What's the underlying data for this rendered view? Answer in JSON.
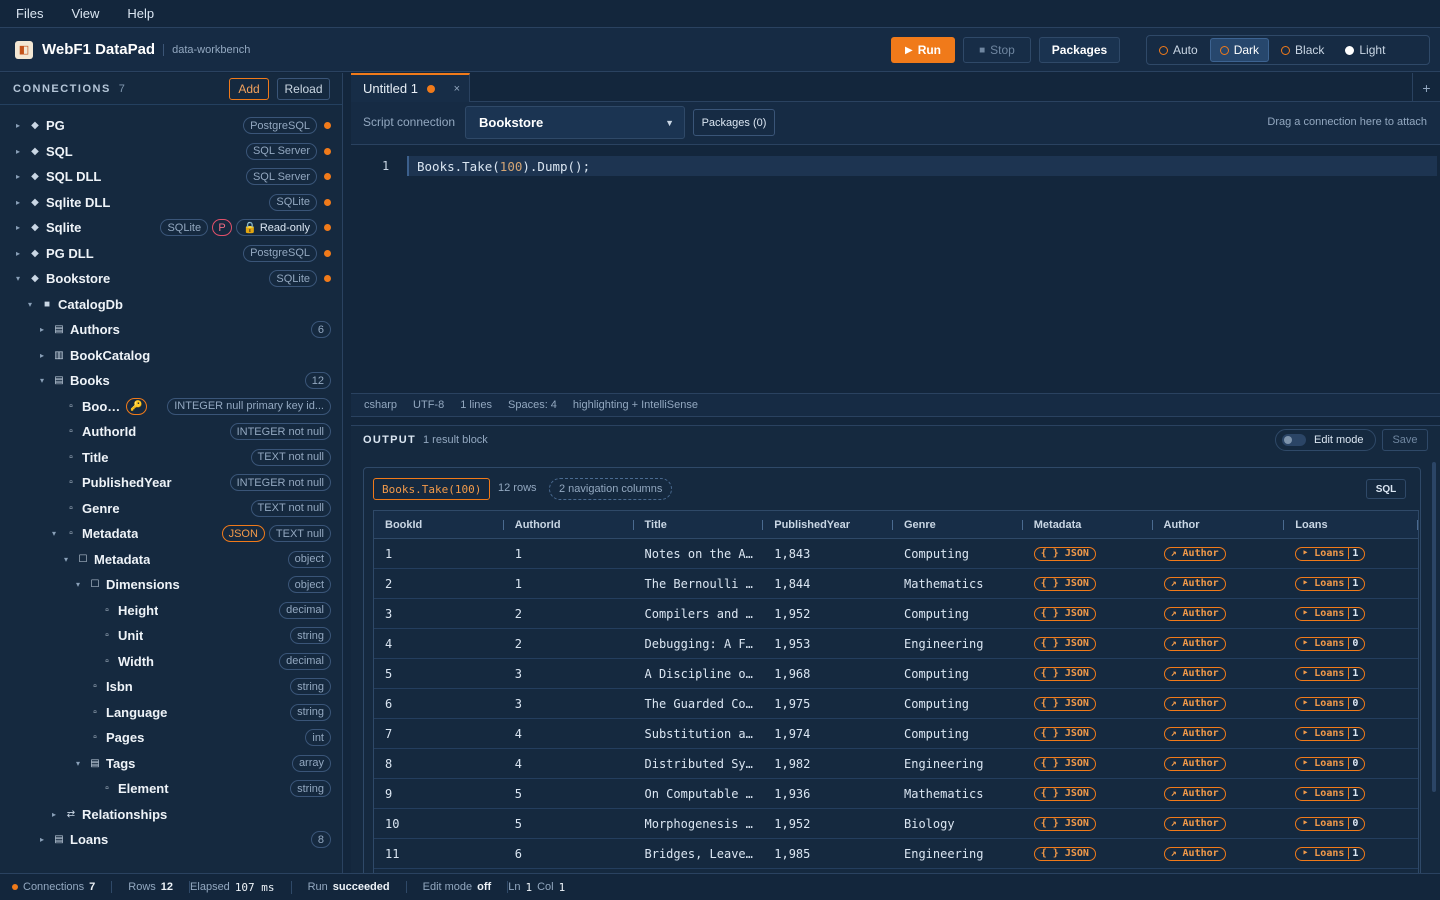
{
  "menu": [
    "Files",
    "View",
    "Help"
  ],
  "app": {
    "logo": "logo-icon",
    "title": "WebF1 DataPad",
    "subtitle": "data-workbench"
  },
  "toolbar": {
    "run": "Run",
    "stop": "Stop",
    "packages": "Packages"
  },
  "themes": [
    "Auto",
    "Dark",
    "Black",
    "Light"
  ],
  "theme_selected": "Dark",
  "sidebar": {
    "header": "CONNECTIONS",
    "count": "7",
    "add": "Add",
    "reload": "Reload",
    "items": [
      {
        "caret": "▸",
        "icon": "◆",
        "name": "PG",
        "tags": [
          "PostgreSQL"
        ],
        "dot": true
      },
      {
        "caret": "▸",
        "icon": "◆",
        "name": "SQL",
        "tags": [
          "SQL Server"
        ],
        "dot": true
      },
      {
        "caret": "▸",
        "icon": "◆",
        "name": "SQL DLL",
        "tags": [
          "SQL Server"
        ],
        "dot": true
      },
      {
        "caret": "▸",
        "icon": "◆",
        "name": "Sqlite DLL",
        "tags": [
          "SQLite"
        ],
        "dot": true
      },
      {
        "caret": "▸",
        "icon": "◆",
        "name": "Sqlite",
        "tags": [
          "SQLite"
        ],
        "p": "P",
        "readonly": "🔒 Read-only",
        "dot": true
      },
      {
        "caret": "▸",
        "icon": "◆",
        "name": "PG DLL",
        "tags": [
          "PostgreSQL"
        ],
        "dot": true
      },
      {
        "caret": "▾",
        "icon": "◆",
        "name": "Bookstore",
        "tags": [
          "SQLite"
        ],
        "dot": true
      },
      {
        "caret": "▾",
        "icon": "■",
        "name": "CatalogDb",
        "indent": 1
      },
      {
        "caret": "▸",
        "icon": "▤",
        "name": "Authors",
        "indent": 2,
        "tags": [
          "6"
        ]
      },
      {
        "caret": "▸",
        "icon": "▥",
        "name": "BookCatalog",
        "indent": 2
      },
      {
        "caret": "▾",
        "icon": "▤",
        "name": "Books",
        "indent": 2,
        "tags": [
          "12"
        ]
      },
      {
        "caret": "",
        "icon": "▫",
        "name": "Boo…",
        "indent": 3,
        "key": "🔑",
        "tags": [
          "INTEGER null primary key id..."
        ]
      },
      {
        "caret": "",
        "icon": "▫",
        "name": "AuthorId",
        "indent": 3,
        "tags": [
          "INTEGER not null"
        ]
      },
      {
        "caret": "",
        "icon": "▫",
        "name": "Title",
        "indent": 3,
        "tags": [
          "TEXT not null"
        ]
      },
      {
        "caret": "",
        "icon": "▫",
        "name": "PublishedYear",
        "indent": 3,
        "tags": [
          "INTEGER not null"
        ]
      },
      {
        "caret": "",
        "icon": "▫",
        "name": "Genre",
        "indent": 3,
        "tags": [
          "TEXT not null"
        ]
      },
      {
        "caret": "▾",
        "icon": "▫",
        "name": "Metadata",
        "indent": 3,
        "json": "JSON",
        "tags": [
          "TEXT null"
        ]
      },
      {
        "caret": "▾",
        "icon": "☐",
        "name": "Metadata",
        "indent": 4,
        "tags": [
          "object"
        ]
      },
      {
        "caret": "▾",
        "icon": "☐",
        "name": "Dimensions",
        "indent": 5,
        "tags": [
          "object"
        ]
      },
      {
        "caret": "",
        "icon": "▫",
        "name": "Height",
        "indent": 6,
        "tags": [
          "decimal"
        ]
      },
      {
        "caret": "",
        "icon": "▫",
        "name": "Unit",
        "indent": 6,
        "tags": [
          "string"
        ]
      },
      {
        "caret": "",
        "icon": "▫",
        "name": "Width",
        "indent": 6,
        "tags": [
          "decimal"
        ]
      },
      {
        "caret": "",
        "icon": "▫",
        "name": "Isbn",
        "indent": 5,
        "tags": [
          "string"
        ]
      },
      {
        "caret": "",
        "icon": "▫",
        "name": "Language",
        "indent": 5,
        "tags": [
          "string"
        ]
      },
      {
        "caret": "",
        "icon": "▫",
        "name": "Pages",
        "indent": 5,
        "tags": [
          "int"
        ]
      },
      {
        "caret": "▾",
        "icon": "▤",
        "name": "Tags",
        "indent": 5,
        "tags": [
          "array"
        ]
      },
      {
        "caret": "",
        "icon": "▫",
        "name": "Element",
        "indent": 6,
        "tags": [
          "string"
        ]
      },
      {
        "caret": "▸",
        "icon": "⇄",
        "name": "Relationships",
        "indent": 3
      },
      {
        "caret": "▸",
        "icon": "▤",
        "name": "Loans",
        "indent": 2,
        "tags": [
          "8"
        ]
      }
    ]
  },
  "tab": {
    "label": "Untitled 1",
    "close": "×",
    "new": "+"
  },
  "script": {
    "connection_label": "Script connection",
    "connection": "Bookstore",
    "packages": "Packages (0)",
    "hint": "Drag a connection here to attach"
  },
  "editor": {
    "line_number": "1",
    "code_parts": [
      "Books.Take(",
      "100",
      ").Dump();"
    ]
  },
  "editor_status": [
    "csharp",
    "UTF-8",
    "1 lines",
    "Spaces: 4",
    "highlighting + IntelliSense"
  ],
  "output": {
    "title": "OUTPUT",
    "subtitle": "1 result block",
    "edit_mode": "Edit mode",
    "save": "Save",
    "result_tag": "Books.Take(100)",
    "rows_label": "12 rows",
    "nav_label": "2 navigation columns",
    "sql": "SQL",
    "columns": [
      "BookId",
      "AuthorId",
      "Title",
      "PublishedYear",
      "Genre",
      "Metadata",
      "Author",
      "Loans"
    ],
    "json_chip": "{ } JSON",
    "author_chip": "↗ Author",
    "loans_chip": "‣ Loans",
    "rows": [
      [
        "1",
        "1",
        "Notes on the A…",
        "1,843",
        "Computing",
        "1"
      ],
      [
        "2",
        "1",
        "The Bernoulli …",
        "1,844",
        "Mathematics",
        "1"
      ],
      [
        "3",
        "2",
        "Compilers and …",
        "1,952",
        "Computing",
        "1"
      ],
      [
        "4",
        "2",
        "Debugging: A F…",
        "1,953",
        "Engineering",
        "0"
      ],
      [
        "5",
        "3",
        "A Discipline o…",
        "1,968",
        "Computing",
        "1"
      ],
      [
        "6",
        "3",
        "The Guarded Co…",
        "1,975",
        "Computing",
        "0"
      ],
      [
        "7",
        "4",
        "Substitution a…",
        "1,974",
        "Computing",
        "1"
      ],
      [
        "8",
        "4",
        "Distributed Sy…",
        "1,982",
        "Engineering",
        "0"
      ],
      [
        "9",
        "5",
        "On Computable …",
        "1,936",
        "Mathematics",
        "1"
      ],
      [
        "10",
        "5",
        "Morphogenesis …",
        "1,952",
        "Biology",
        "0"
      ],
      [
        "11",
        "6",
        "Bridges, Leave…",
        "1,985",
        "Engineering",
        "1"
      ]
    ]
  },
  "statusbar": {
    "connections_label": "Connections",
    "connections": "7",
    "rows_label": "Rows",
    "rows": "12",
    "elapsed_label": "Elapsed",
    "elapsed": "107 ms",
    "run_label": "Run",
    "run": "succeeded",
    "edit_label": "Edit mode",
    "edit": "off",
    "ln_label": "Ln",
    "ln": "1",
    "col_label": "Col",
    "col": "1"
  },
  "colors": {
    "accent": "#f07a1a",
    "background": "#13263c",
    "panel": "#15293f"
  }
}
